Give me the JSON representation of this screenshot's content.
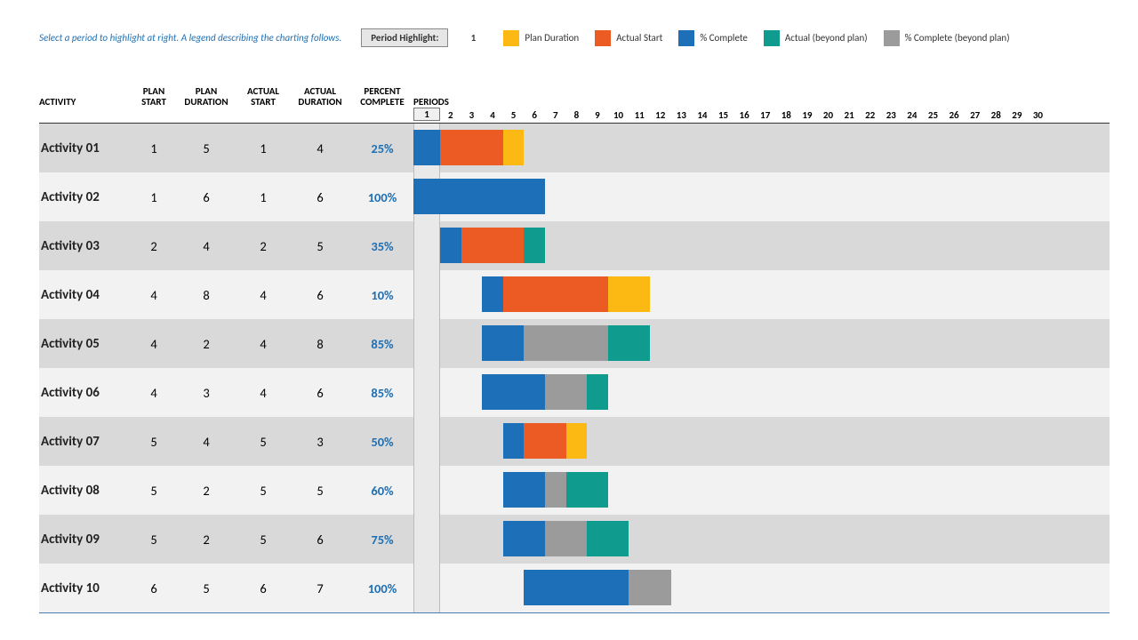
{
  "hint": "Select a period to highlight at right.  A legend describing the charting follows.",
  "period_highlight_label": "Period Highlight:",
  "period_highlight_value": "1",
  "legend": [
    {
      "color": "#fcb813",
      "label": "Plan Duration"
    },
    {
      "color": "#ed5b25",
      "label": "Actual Start"
    },
    {
      "color": "#1d6fb7",
      "label": "% Complete"
    },
    {
      "color": "#0f9b8e",
      "label": "Actual (beyond plan)"
    },
    {
      "color": "#9b9b9b",
      "label": "% Complete (beyond plan)"
    }
  ],
  "headers": {
    "activity": "ACTIVITY",
    "plan_start": "PLAN START",
    "plan_duration": "PLAN DURATION",
    "actual_start": "ACTUAL START",
    "actual_duration": "ACTUAL DURATION",
    "percent_complete": "PERCENT COMPLETE",
    "periods": "PERIODS"
  },
  "periods_count": 30,
  "colors": {
    "plan": "#fcb813",
    "actual": "#ed5b25",
    "pct": "#1d6fb7",
    "beyond": "#0f9b8e",
    "pct_beyond": "#9b9b9b"
  },
  "chart_data": {
    "type": "bar",
    "title": "Project Planner Gantt",
    "xlabel": "Periods",
    "ylabel": "Activity",
    "xlim": [
      1,
      30
    ],
    "highlight_period": 1,
    "categories": [
      "Activity 01",
      "Activity 02",
      "Activity 03",
      "Activity 04",
      "Activity 05",
      "Activity 06",
      "Activity 07",
      "Activity 08",
      "Activity 09",
      "Activity 10"
    ],
    "series": [
      {
        "name": "Plan Start",
        "values": [
          1,
          1,
          2,
          4,
          4,
          4,
          5,
          5,
          5,
          6
        ]
      },
      {
        "name": "Plan Duration",
        "values": [
          5,
          6,
          4,
          8,
          2,
          3,
          4,
          2,
          2,
          5
        ]
      },
      {
        "name": "Actual Start",
        "values": [
          1,
          1,
          2,
          4,
          4,
          4,
          5,
          5,
          5,
          6
        ]
      },
      {
        "name": "Actual Duration",
        "values": [
          4,
          6,
          5,
          6,
          8,
          6,
          3,
          5,
          6,
          7
        ]
      },
      {
        "name": "% Complete",
        "values": [
          25,
          100,
          35,
          10,
          85,
          85,
          50,
          60,
          75,
          100
        ]
      }
    ],
    "rows": [
      {
        "name": "Activity 01",
        "plan_start": 1,
        "plan_duration": 5,
        "actual_start": 1,
        "actual_duration": 4,
        "percent_complete": 25,
        "segments": [
          {
            "kind": "pct",
            "start": 1,
            "len": 1
          },
          {
            "kind": "actual",
            "start": 2,
            "len": 3
          },
          {
            "kind": "plan",
            "start": 5,
            "len": 1
          }
        ]
      },
      {
        "name": "Activity 02",
        "plan_start": 1,
        "plan_duration": 6,
        "actual_start": 1,
        "actual_duration": 6,
        "percent_complete": 100,
        "segments": [
          {
            "kind": "pct",
            "start": 1,
            "len": 6
          }
        ]
      },
      {
        "name": "Activity 03",
        "plan_start": 2,
        "plan_duration": 4,
        "actual_start": 2,
        "actual_duration": 5,
        "percent_complete": 35,
        "segments": [
          {
            "kind": "pct",
            "start": 2,
            "len": 1
          },
          {
            "kind": "actual",
            "start": 3,
            "len": 3
          },
          {
            "kind": "beyond",
            "start": 6,
            "len": 1
          }
        ]
      },
      {
        "name": "Activity 04",
        "plan_start": 4,
        "plan_duration": 8,
        "actual_start": 4,
        "actual_duration": 6,
        "percent_complete": 10,
        "segments": [
          {
            "kind": "pct",
            "start": 4,
            "len": 1
          },
          {
            "kind": "actual",
            "start": 5,
            "len": 5
          },
          {
            "kind": "plan",
            "start": 10,
            "len": 2
          }
        ]
      },
      {
        "name": "Activity 05",
        "plan_start": 4,
        "plan_duration": 2,
        "actual_start": 4,
        "actual_duration": 8,
        "percent_complete": 85,
        "segments": [
          {
            "kind": "pct",
            "start": 4,
            "len": 2
          },
          {
            "kind": "pct_beyond",
            "start": 6,
            "len": 4
          },
          {
            "kind": "beyond",
            "start": 10,
            "len": 2
          }
        ]
      },
      {
        "name": "Activity 06",
        "plan_start": 4,
        "plan_duration": 3,
        "actual_start": 4,
        "actual_duration": 6,
        "percent_complete": 85,
        "segments": [
          {
            "kind": "pct",
            "start": 4,
            "len": 3
          },
          {
            "kind": "pct_beyond",
            "start": 7,
            "len": 2
          },
          {
            "kind": "beyond",
            "start": 9,
            "len": 1
          }
        ]
      },
      {
        "name": "Activity 07",
        "plan_start": 5,
        "plan_duration": 4,
        "actual_start": 5,
        "actual_duration": 3,
        "percent_complete": 50,
        "segments": [
          {
            "kind": "pct",
            "start": 5,
            "len": 1
          },
          {
            "kind": "actual",
            "start": 6,
            "len": 2
          },
          {
            "kind": "plan",
            "start": 8,
            "len": 1
          }
        ]
      },
      {
        "name": "Activity 08",
        "plan_start": 5,
        "plan_duration": 2,
        "actual_start": 5,
        "actual_duration": 5,
        "percent_complete": 60,
        "segments": [
          {
            "kind": "pct",
            "start": 5,
            "len": 2
          },
          {
            "kind": "pct_beyond",
            "start": 7,
            "len": 1
          },
          {
            "kind": "beyond",
            "start": 8,
            "len": 2
          }
        ]
      },
      {
        "name": "Activity 09",
        "plan_start": 5,
        "plan_duration": 2,
        "actual_start": 5,
        "actual_duration": 6,
        "percent_complete": 75,
        "segments": [
          {
            "kind": "pct",
            "start": 5,
            "len": 2
          },
          {
            "kind": "pct_beyond",
            "start": 7,
            "len": 2
          },
          {
            "kind": "beyond",
            "start": 9,
            "len": 2
          }
        ]
      },
      {
        "name": "Activity 10",
        "plan_start": 6,
        "plan_duration": 5,
        "actual_start": 6,
        "actual_duration": 7,
        "percent_complete": 100,
        "segments": [
          {
            "kind": "pct",
            "start": 6,
            "len": 5
          },
          {
            "kind": "pct_beyond",
            "start": 11,
            "len": 2
          }
        ]
      }
    ]
  }
}
